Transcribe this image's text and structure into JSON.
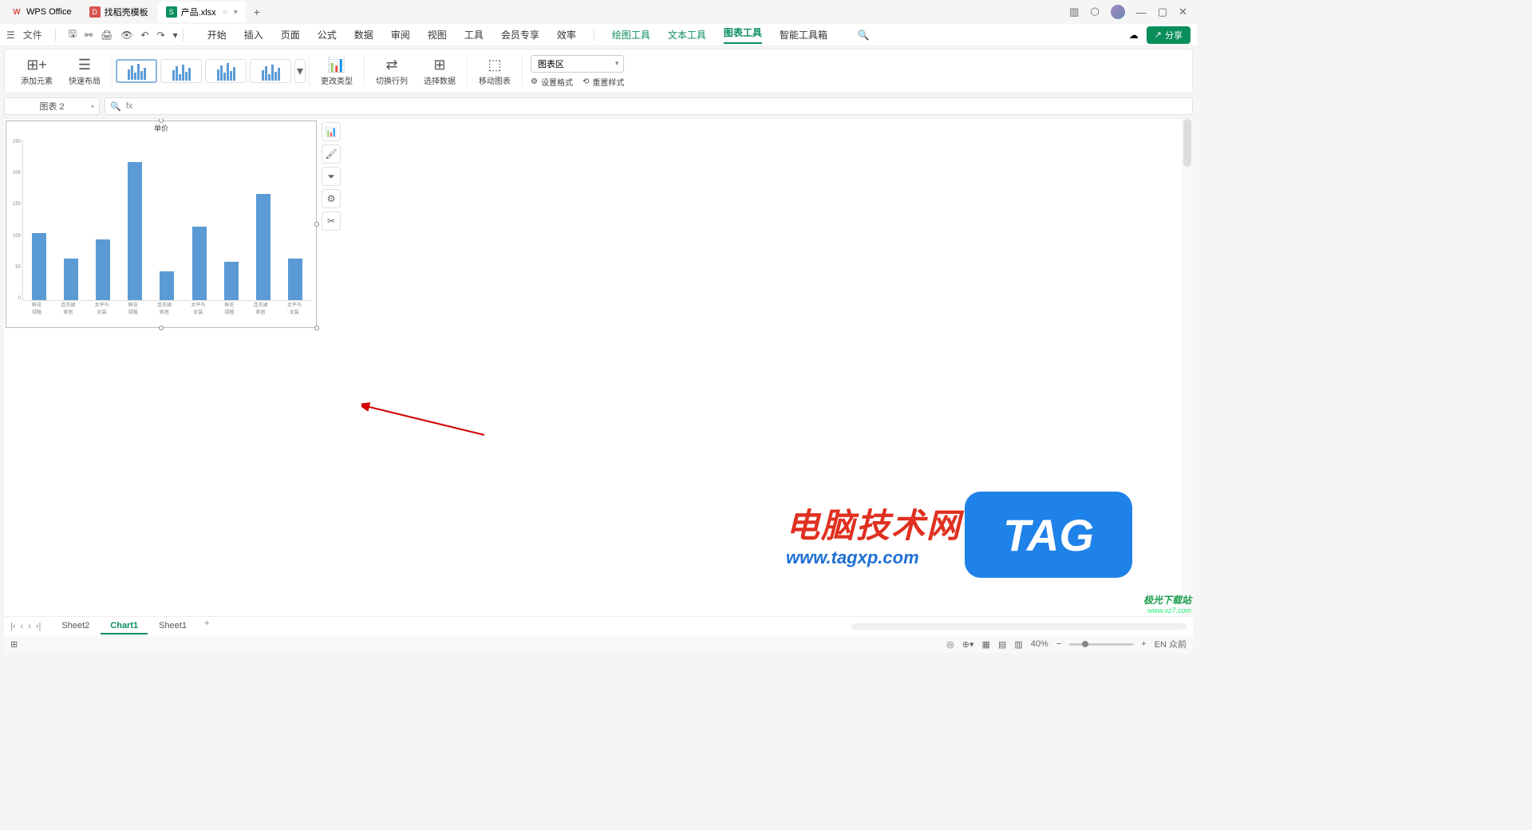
{
  "tabs": {
    "wps": "WPS Office",
    "template": "找稻壳模板",
    "file": "产品.xlsx",
    "status_indicator": "○",
    "add": "+"
  },
  "win_controls": {
    "min": "—",
    "max": "▢",
    "close": "✕"
  },
  "menu": {
    "file": "文件",
    "items": [
      "开始",
      "插入",
      "页面",
      "公式",
      "数据",
      "审阅",
      "视图",
      "工具",
      "会员专享",
      "效率"
    ],
    "tool_items": [
      "绘图工具",
      "文本工具",
      "图表工具",
      "智能工具箱"
    ],
    "active": "图表工具"
  },
  "ribbon": {
    "add_element": "添加元素",
    "quick_layout": "快速布局",
    "change_type": "更改类型",
    "switch_rc": "切换行列",
    "select_data": "选择数据",
    "move_chart": "移动图表",
    "chart_area": "图表区",
    "set_format": "设置格式",
    "reset_style": "重置样式"
  },
  "name_box": "图表 2",
  "fx_label": "fx",
  "chart_data": {
    "type": "bar",
    "title": "单价",
    "categories": [
      "鲜花",
      "连衣裙",
      "太平鸟",
      "鲜花",
      "连衣裙",
      "太平鸟",
      "鲜花",
      "连衣裙",
      "太平鸟"
    ],
    "sub_categories": [
      "绿植",
      "家居",
      "女装",
      "绿植",
      "家居",
      "女装",
      "绿植",
      "家居",
      "女装"
    ],
    "values": [
      105,
      65,
      95,
      215,
      45,
      115,
      60,
      165,
      65
    ],
    "ylim": [
      0,
      250
    ],
    "yticks": [
      0,
      50,
      100,
      150,
      200,
      250
    ],
    "color": "#5b9bd5"
  },
  "side_tools": [
    "chart-icon",
    "brush-icon",
    "filter-icon",
    "gear-icon",
    "tools-icon"
  ],
  "sheets": {
    "list": [
      "Sheet2",
      "Chart1",
      "Sheet1"
    ],
    "active": "Chart1"
  },
  "status": {
    "zoom": "40%",
    "ime": "EN 众前"
  },
  "watermark": {
    "cn": "电脑技术网",
    "url": "www.tagxp.com",
    "tag": "TAG",
    "badge_l1": "极光下载站",
    "badge_l2": "www.xz7.com"
  },
  "share_label": "分享"
}
